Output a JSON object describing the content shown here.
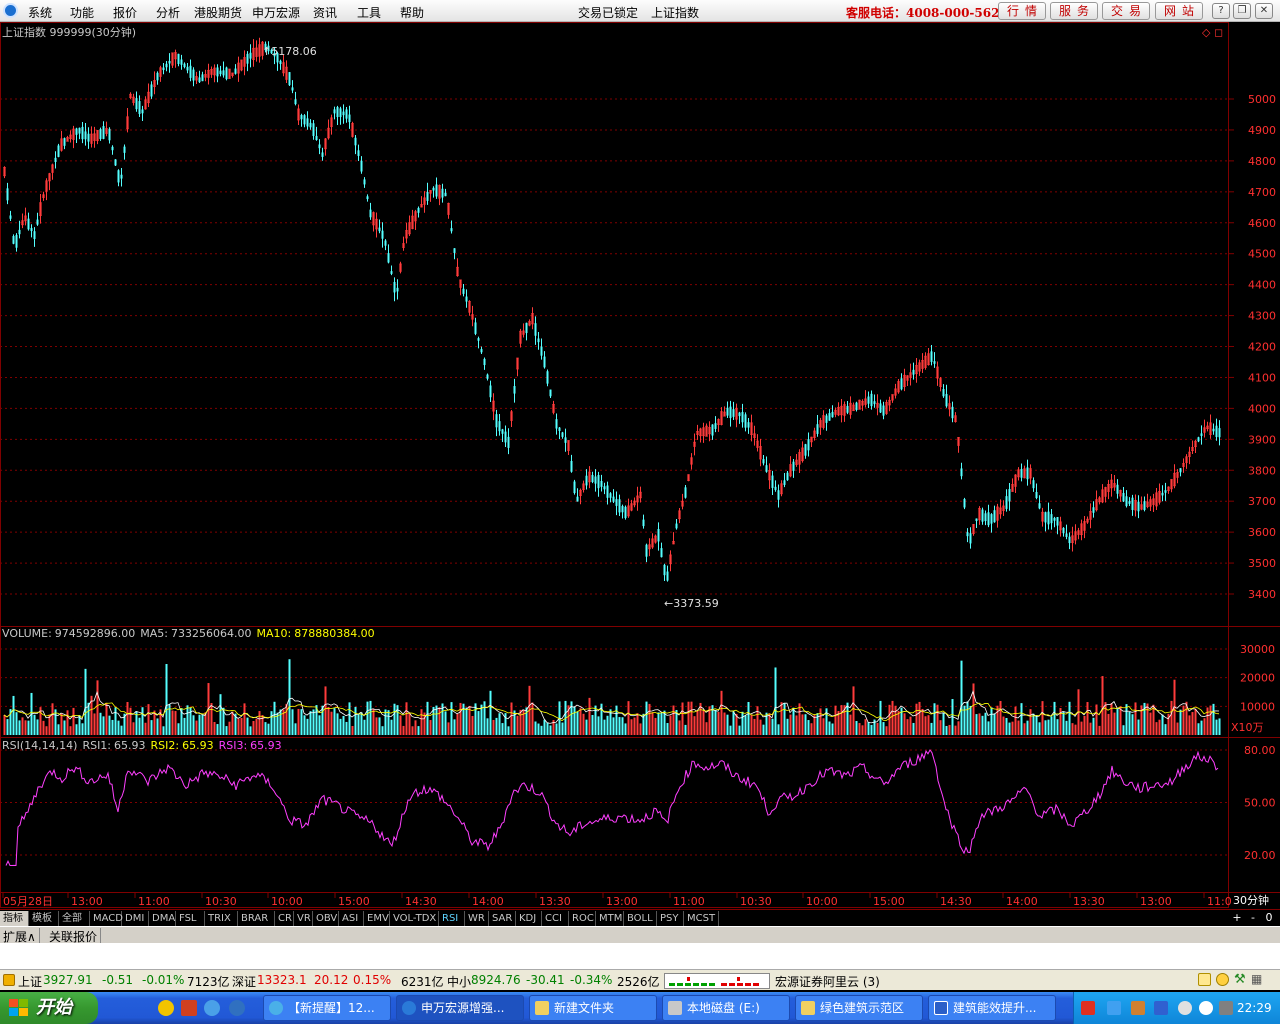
{
  "menu": {
    "items": [
      "系统",
      "功能",
      "报价",
      "分析",
      "港股期货",
      "申万宏源",
      "资讯",
      "工具",
      "帮助"
    ],
    "center_status": [
      "交易已锁定",
      "上证指数"
    ],
    "hotline": "客服电话：4008-000-562",
    "buttons": [
      "行情",
      "服务",
      "交易",
      "网站"
    ]
  },
  "chart": {
    "header": "上证指数 999999(30分钟)",
    "price_axis": [
      "5000",
      "4900",
      "4800",
      "4700",
      "4600",
      "4500",
      "4400",
      "4300",
      "4200",
      "4100",
      "4000",
      "3900",
      "3800",
      "3700",
      "3600",
      "3500",
      "3400"
    ],
    "high_label": "5178.06",
    "low_label": "3373.59",
    "volume_label": "VOLUME:",
    "volume_value": "974592896.00",
    "ma5_label": "MA5:",
    "ma5_value": "733256064.00",
    "ma10_label": "MA10:",
    "ma10_value": "878880384.00",
    "volume_axis": [
      "30000",
      "20000",
      "10000"
    ],
    "volume_unit": "X10万",
    "rsi_label": "RSI(14,14,14)",
    "rsi1_label": "RSI1:",
    "rsi1": "65.93",
    "rsi2_label": "RSI2:",
    "rsi2": "65.93",
    "rsi3_label": "RSI3:",
    "rsi3": "65.93",
    "rsi_axis": [
      "80.00",
      "50.00",
      "20.00"
    ],
    "time_axis": [
      "05月28日",
      "13:00",
      "11:00",
      "10:30",
      "10:00",
      "15:00",
      "14:30",
      "14:00",
      "13:30",
      "13:00",
      "11:00",
      "10:30",
      "10:00",
      "15:00",
      "14:30",
      "14:00",
      "13:30",
      "13:00",
      "11:0"
    ],
    "period_label": "30分钟",
    "colors": {
      "up": "#ff3b3b",
      "down": "#54ffff",
      "grid": "#800000",
      "ma5": "#ffffff",
      "ma10": "#ffff00",
      "rsi": "#ff40ff"
    }
  },
  "tabs": [
    "指标",
    "模板",
    "全部",
    "MACD",
    "DMI",
    "DMA",
    "FSL",
    "TRIX",
    "BRAR",
    "CR",
    "VR",
    "OBV",
    "ASI",
    "EMV",
    "VOL-TDX",
    "RSI",
    "WR",
    "SAR",
    "KDJ",
    "CCI",
    "ROC",
    "MTM",
    "BOLL",
    "PSY",
    "MCST"
  ],
  "tab_selected": "RSI",
  "tab_controls": [
    "+",
    "-",
    "0"
  ],
  "ext_tabs": [
    "扩展∧",
    "关联报价"
  ],
  "status": {
    "sh_label": "上证",
    "sh_index": "3927.91",
    "sh_change": "-0.51",
    "sh_pct": "-0.01%",
    "sh_amount": "7123亿",
    "sz_label": "深证",
    "sz_index": "13323.1",
    "sz_change": "20.12",
    "sz_pct": "0.15%",
    "sz_amount": "6231亿",
    "zx_label": "中小",
    "zx_index": "8924.76",
    "zx_change": "-30.41",
    "zx_pct": "-0.34%",
    "zx_amount": "2526亿",
    "server": "宏源证券阿里云 (3)"
  },
  "taskbar": {
    "start": "开始",
    "tasks": [
      "【新提醒】12...",
      "申万宏源增强...",
      "新建文件夹",
      "本地磁盘 (E:)",
      "绿色建筑示范区",
      "建筑能效提升..."
    ],
    "clock": "22:29"
  }
}
